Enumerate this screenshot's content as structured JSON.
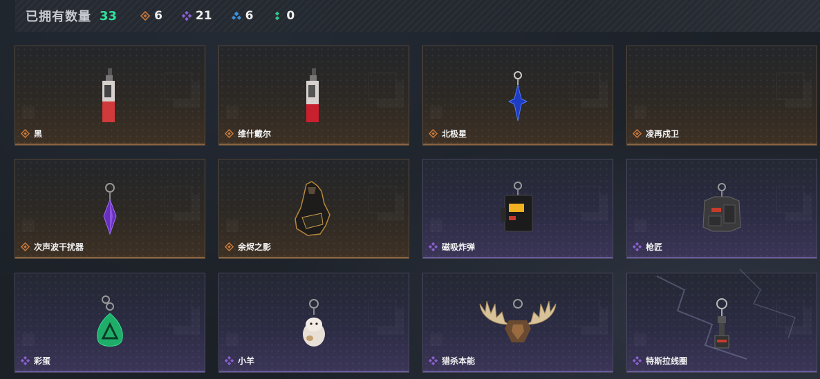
{
  "header": {
    "title": "已拥有数量",
    "total": "33",
    "stats": [
      {
        "icon": "orange-rarity-icon",
        "color": "#c9793a",
        "count": "6"
      },
      {
        "icon": "purple-rarity-icon",
        "color": "#8a5fd0",
        "count": "21"
      },
      {
        "icon": "blue-rarity-icon",
        "color": "#3b8fd6",
        "count": "6"
      },
      {
        "icon": "green-rarity-icon",
        "color": "#2fc88a",
        "count": "0"
      }
    ]
  },
  "rarity_colors": {
    "orange": "#c9793a",
    "purple": "#8a5fd0"
  },
  "cards": [
    {
      "name": "黑",
      "rarity": "orange",
      "art": "red-pendant-charm"
    },
    {
      "name": "维什戴尔",
      "rarity": "orange",
      "art": "red-pendant-charm"
    },
    {
      "name": "北极星",
      "rarity": "orange",
      "art": "blue-star-charm"
    },
    {
      "name": "凌再戍卫",
      "rarity": "orange",
      "art": "none"
    },
    {
      "name": "次声波干扰器",
      "rarity": "orange",
      "art": "purple-crystal-charm"
    },
    {
      "name": "余烬之影",
      "rarity": "orange",
      "art": "dark-figure-charm"
    },
    {
      "name": "磁吸炸弹",
      "rarity": "purple",
      "art": "bomb-device-charm"
    },
    {
      "name": "枪匠",
      "rarity": "purple",
      "art": "armor-vest-charm"
    },
    {
      "name": "彩蛋",
      "rarity": "purple",
      "art": "green-egg-charm"
    },
    {
      "name": "小羊",
      "rarity": "purple",
      "art": "lamb-charm"
    },
    {
      "name": "猎杀本能",
      "rarity": "purple",
      "art": "antlers-charm"
    },
    {
      "name": "特斯拉线圈",
      "rarity": "purple",
      "art": "tesla-coil-charm"
    }
  ]
}
